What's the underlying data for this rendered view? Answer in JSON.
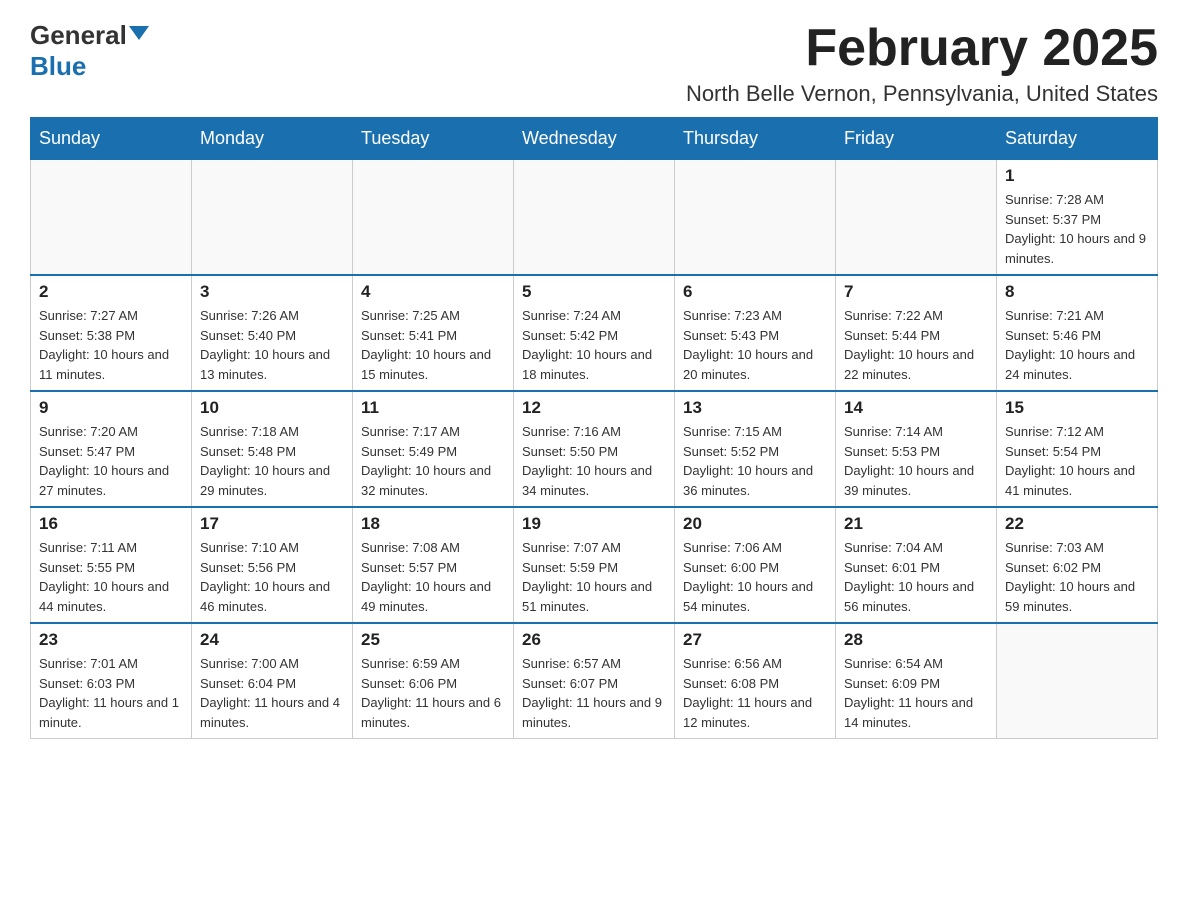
{
  "logo": {
    "general": "General",
    "blue": "Blue"
  },
  "title": "February 2025",
  "location": "North Belle Vernon, Pennsylvania, United States",
  "days_of_week": [
    "Sunday",
    "Monday",
    "Tuesday",
    "Wednesday",
    "Thursday",
    "Friday",
    "Saturday"
  ],
  "weeks": [
    [
      {
        "day": "",
        "info": ""
      },
      {
        "day": "",
        "info": ""
      },
      {
        "day": "",
        "info": ""
      },
      {
        "day": "",
        "info": ""
      },
      {
        "day": "",
        "info": ""
      },
      {
        "day": "",
        "info": ""
      },
      {
        "day": "1",
        "info": "Sunrise: 7:28 AM\nSunset: 5:37 PM\nDaylight: 10 hours and 9 minutes."
      }
    ],
    [
      {
        "day": "2",
        "info": "Sunrise: 7:27 AM\nSunset: 5:38 PM\nDaylight: 10 hours and 11 minutes."
      },
      {
        "day": "3",
        "info": "Sunrise: 7:26 AM\nSunset: 5:40 PM\nDaylight: 10 hours and 13 minutes."
      },
      {
        "day": "4",
        "info": "Sunrise: 7:25 AM\nSunset: 5:41 PM\nDaylight: 10 hours and 15 minutes."
      },
      {
        "day": "5",
        "info": "Sunrise: 7:24 AM\nSunset: 5:42 PM\nDaylight: 10 hours and 18 minutes."
      },
      {
        "day": "6",
        "info": "Sunrise: 7:23 AM\nSunset: 5:43 PM\nDaylight: 10 hours and 20 minutes."
      },
      {
        "day": "7",
        "info": "Sunrise: 7:22 AM\nSunset: 5:44 PM\nDaylight: 10 hours and 22 minutes."
      },
      {
        "day": "8",
        "info": "Sunrise: 7:21 AM\nSunset: 5:46 PM\nDaylight: 10 hours and 24 minutes."
      }
    ],
    [
      {
        "day": "9",
        "info": "Sunrise: 7:20 AM\nSunset: 5:47 PM\nDaylight: 10 hours and 27 minutes."
      },
      {
        "day": "10",
        "info": "Sunrise: 7:18 AM\nSunset: 5:48 PM\nDaylight: 10 hours and 29 minutes."
      },
      {
        "day": "11",
        "info": "Sunrise: 7:17 AM\nSunset: 5:49 PM\nDaylight: 10 hours and 32 minutes."
      },
      {
        "day": "12",
        "info": "Sunrise: 7:16 AM\nSunset: 5:50 PM\nDaylight: 10 hours and 34 minutes."
      },
      {
        "day": "13",
        "info": "Sunrise: 7:15 AM\nSunset: 5:52 PM\nDaylight: 10 hours and 36 minutes."
      },
      {
        "day": "14",
        "info": "Sunrise: 7:14 AM\nSunset: 5:53 PM\nDaylight: 10 hours and 39 minutes."
      },
      {
        "day": "15",
        "info": "Sunrise: 7:12 AM\nSunset: 5:54 PM\nDaylight: 10 hours and 41 minutes."
      }
    ],
    [
      {
        "day": "16",
        "info": "Sunrise: 7:11 AM\nSunset: 5:55 PM\nDaylight: 10 hours and 44 minutes."
      },
      {
        "day": "17",
        "info": "Sunrise: 7:10 AM\nSunset: 5:56 PM\nDaylight: 10 hours and 46 minutes."
      },
      {
        "day": "18",
        "info": "Sunrise: 7:08 AM\nSunset: 5:57 PM\nDaylight: 10 hours and 49 minutes."
      },
      {
        "day": "19",
        "info": "Sunrise: 7:07 AM\nSunset: 5:59 PM\nDaylight: 10 hours and 51 minutes."
      },
      {
        "day": "20",
        "info": "Sunrise: 7:06 AM\nSunset: 6:00 PM\nDaylight: 10 hours and 54 minutes."
      },
      {
        "day": "21",
        "info": "Sunrise: 7:04 AM\nSunset: 6:01 PM\nDaylight: 10 hours and 56 minutes."
      },
      {
        "day": "22",
        "info": "Sunrise: 7:03 AM\nSunset: 6:02 PM\nDaylight: 10 hours and 59 minutes."
      }
    ],
    [
      {
        "day": "23",
        "info": "Sunrise: 7:01 AM\nSunset: 6:03 PM\nDaylight: 11 hours and 1 minute."
      },
      {
        "day": "24",
        "info": "Sunrise: 7:00 AM\nSunset: 6:04 PM\nDaylight: 11 hours and 4 minutes."
      },
      {
        "day": "25",
        "info": "Sunrise: 6:59 AM\nSunset: 6:06 PM\nDaylight: 11 hours and 6 minutes."
      },
      {
        "day": "26",
        "info": "Sunrise: 6:57 AM\nSunset: 6:07 PM\nDaylight: 11 hours and 9 minutes."
      },
      {
        "day": "27",
        "info": "Sunrise: 6:56 AM\nSunset: 6:08 PM\nDaylight: 11 hours and 12 minutes."
      },
      {
        "day": "28",
        "info": "Sunrise: 6:54 AM\nSunset: 6:09 PM\nDaylight: 11 hours and 14 minutes."
      },
      {
        "day": "",
        "info": ""
      }
    ]
  ]
}
